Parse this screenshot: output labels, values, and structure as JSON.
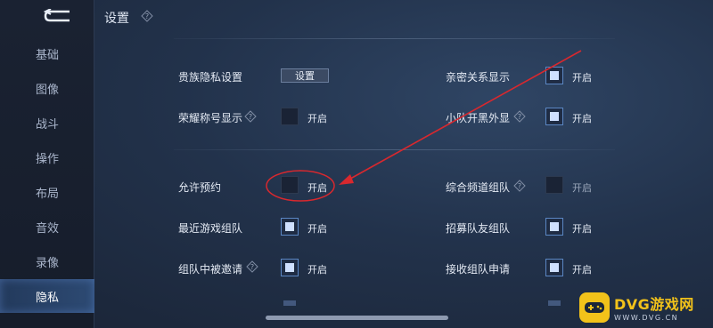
{
  "header": {
    "title": "设置"
  },
  "sidebar": {
    "items": [
      {
        "label": "基础"
      },
      {
        "label": "图像"
      },
      {
        "label": "战斗"
      },
      {
        "label": "操作"
      },
      {
        "label": "布局"
      },
      {
        "label": "音效"
      },
      {
        "label": "录像"
      },
      {
        "label": "隐私"
      },
      {
        "label": ""
      }
    ],
    "active_index": 7
  },
  "settings": {
    "noble_privacy": {
      "label": "贵族隐私设置",
      "button": "设置"
    },
    "intimate_display": {
      "label": "亲密关系显示",
      "checked": true,
      "status": "开启"
    },
    "honor_title_display": {
      "label": "荣耀称号显示",
      "checked": false,
      "status": "开启"
    },
    "squad_black_look": {
      "label": "小队开黑外显",
      "checked": true,
      "status": "开启"
    },
    "allow_reservation": {
      "label": "允许预约",
      "checked": false,
      "status": "开启"
    },
    "channel_team": {
      "label": "综合频道组队",
      "checked": false,
      "status": "开启"
    },
    "recent_game_team": {
      "label": "最近游戏组队",
      "checked": true,
      "status": "开启"
    },
    "recruit_friend_team": {
      "label": "招募队友组队",
      "checked": true,
      "status": "开启"
    },
    "team_invite": {
      "label": "组队中被邀请",
      "checked": true,
      "status": "开启"
    },
    "receive_team_request": {
      "label": "接收组队申请",
      "checked": true,
      "status": "开启"
    }
  },
  "colors": {
    "accent": "#5b87c4",
    "annotation": "#d8282e",
    "watermark": "#f2c21a"
  },
  "watermark": {
    "title": "DVG游戏网",
    "subtitle": "WWW.DVG.CN"
  }
}
